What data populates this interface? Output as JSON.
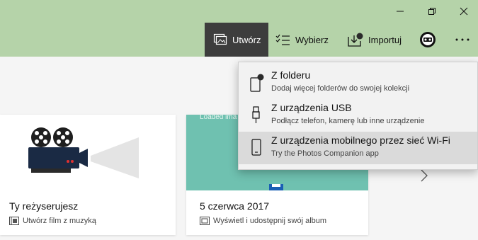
{
  "toolbar": {
    "create_label": "Utwórz",
    "select_label": "Wybierz",
    "import_label": "Importuj"
  },
  "cards": [
    {
      "title": "Ty reżyserujesz",
      "subtitle": "Utwórz film z muzyką"
    },
    {
      "title": "5 czerwca 2017",
      "subtitle": "Wyświetl i udostępnij swój album",
      "overlay_text": "Loaded ima"
    }
  ],
  "dropdown": {
    "items": [
      {
        "title": "Z folderu",
        "subtitle": "Dodaj więcej folderów do swojej kolekcji"
      },
      {
        "title": "Z urządzenia USB",
        "subtitle": "Podłącz telefon, kamerę lub inne urządzenie"
      },
      {
        "title": "Z urządzenia mobilnego przez sieć Wi-Fi",
        "subtitle": "Try the Photos Companion app"
      }
    ]
  },
  "colors": {
    "titlebar": "#b5d3a9",
    "active_button": "#3d3d3d",
    "card_image_teal": "#6fc1b0",
    "dropdown_bg": "#f2f2f2",
    "dropdown_hover": "#dadada"
  }
}
